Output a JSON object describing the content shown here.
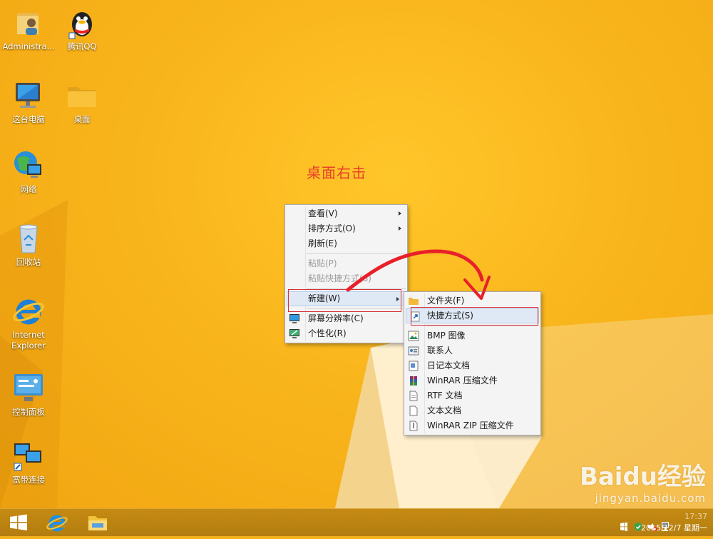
{
  "desktop": {
    "icons": [
      {
        "label": "Administra..."
      },
      {
        "label": "腾讯QQ"
      },
      {
        "label": "这台电脑"
      },
      {
        "label": "桌面"
      },
      {
        "label": "网络"
      },
      {
        "label": "回收站"
      },
      {
        "label": "Internet Explorer"
      },
      {
        "label": "控制面板"
      },
      {
        "label": "宽带连接"
      }
    ],
    "annotation": "桌面右击"
  },
  "context_menu": {
    "items": [
      {
        "label": "查看(V)"
      },
      {
        "label": "排序方式(O)"
      },
      {
        "label": "刷新(E)"
      },
      {
        "label": "粘贴(P)"
      },
      {
        "label": "粘贴快捷方式(S)"
      },
      {
        "label": "新建(W)"
      },
      {
        "label": "屏幕分辨率(C)"
      },
      {
        "label": "个性化(R)"
      }
    ]
  },
  "submenu": {
    "items": [
      {
        "label": "文件夹(F)"
      },
      {
        "label": "快捷方式(S)"
      },
      {
        "label": "BMP 图像"
      },
      {
        "label": "联系人"
      },
      {
        "label": "日记本文档"
      },
      {
        "label": "WinRAR 压缩文件"
      },
      {
        "label": "RTF 文档"
      },
      {
        "label": "文本文档"
      },
      {
        "label": "WinRAR ZIP 压缩文件"
      }
    ]
  },
  "taskbar": {
    "time": "17:37",
    "date": "2015/12/7 星期一"
  },
  "watermark": {
    "brand": "Baidu经验",
    "url": "jingyan.baidu.com"
  },
  "colors": {
    "desktop": "#f5b21a",
    "highlight_box": "#d8303a",
    "annotation": "#e6402a"
  }
}
